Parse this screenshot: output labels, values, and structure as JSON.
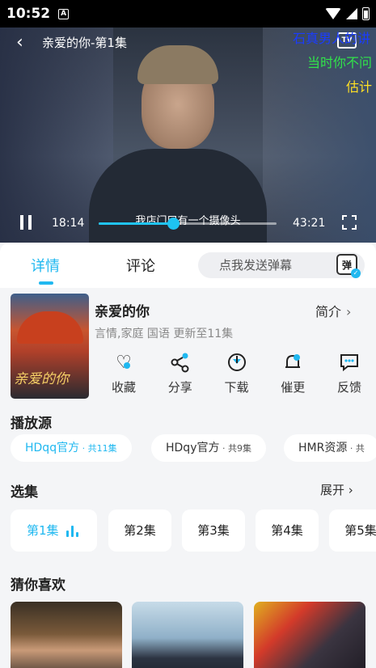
{
  "status": {
    "time": "10:52",
    "a_icon": "A"
  },
  "player": {
    "title": "亲爱的你-第1集",
    "tv_label": "TV",
    "danmu": [
      "石真男人的讲",
      "当时你不问",
      "估计"
    ],
    "subtitle": "我店门口有一个摄像头",
    "current_time": "18:14",
    "duration": "43:21",
    "progress": 0.42
  },
  "tabs": {
    "detail": "详情",
    "comment": "评论",
    "danmu_placeholder": "点我发送弹幕",
    "danmu_btn": "弹"
  },
  "show": {
    "name": "亲爱的你",
    "intro": "简介",
    "meta": "言情,家庭 国语 更新至11集",
    "poster_title": "亲爱的你",
    "actions": [
      {
        "label": "收藏",
        "icon": "heart-icon"
      },
      {
        "label": "分享",
        "icon": "share-icon"
      },
      {
        "label": "下载",
        "icon": "download-icon"
      },
      {
        "label": "催更",
        "icon": "bell-icon"
      },
      {
        "label": "反馈",
        "icon": "feedback-icon"
      }
    ]
  },
  "sources": {
    "title": "播放源",
    "items": [
      {
        "name": "HDqq官方",
        "count": " · 共11集"
      },
      {
        "name": "HDqy官方",
        "count": " · 共9集"
      },
      {
        "name": "HMR资源",
        "count": " · 共"
      }
    ]
  },
  "episodes": {
    "title": "选集",
    "more": "展开",
    "items": [
      "第1集",
      "第2集",
      "第3集",
      "第4集",
      "第5集"
    ]
  },
  "recommend": {
    "title": "猜你喜欢"
  },
  "colors": {
    "accent": "#20b8f0"
  }
}
